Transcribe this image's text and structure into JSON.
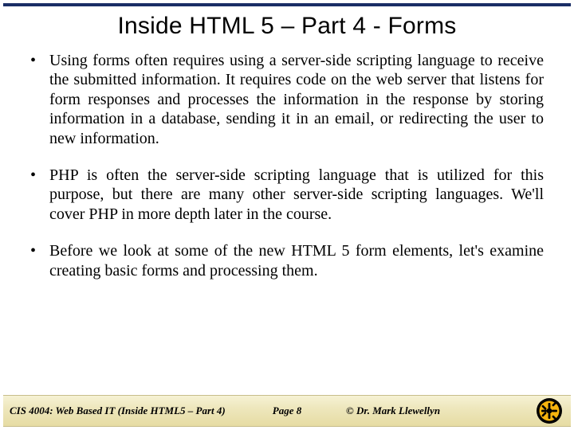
{
  "title": "Inside HTML 5 – Part 4 - Forms",
  "bullets": [
    "Using forms often requires using a server-side scripting language to receive the submitted information.  It requires code on the web server that listens for form responses and processes the information in the response by storing information in a database, sending it in an email, or redirecting the user to new information.",
    "PHP is often the server-side scripting language that is utilized for this purpose, but there are many other server-side scripting languages.  We'll cover PHP in more depth later in the course.",
    "Before we look at some of the new HTML 5 form elements, let's examine creating basic forms and processing them."
  ],
  "footer": {
    "course": "CIS 4004: Web Based IT (Inside HTML5 – Part 4)",
    "page": "Page 8",
    "author": "© Dr. Mark Llewellyn"
  }
}
